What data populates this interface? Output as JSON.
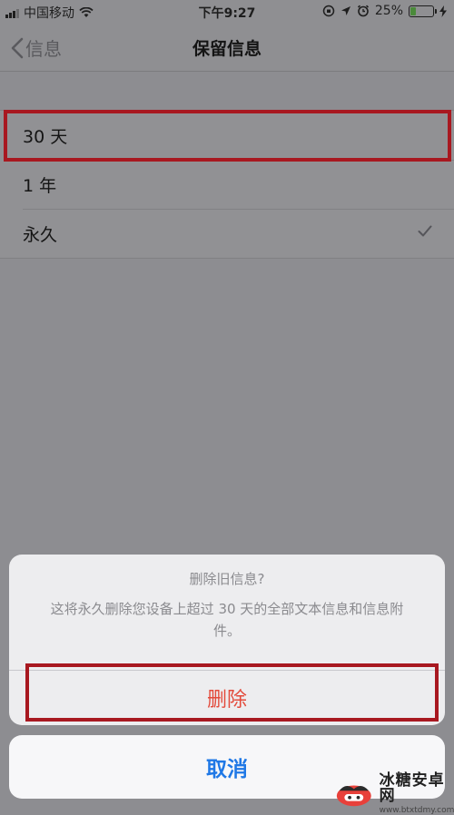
{
  "status_bar": {
    "carrier": "中国移动",
    "time": "下午9:27",
    "battery_percent": "25%",
    "battery_level": 0.25,
    "battery_color": "#4a8a3a"
  },
  "nav": {
    "back_label": "信息",
    "title": "保留信息"
  },
  "options": [
    {
      "label": "30 天",
      "selected": false
    },
    {
      "label": "1 年",
      "selected": false
    },
    {
      "label": "永久",
      "selected": true
    }
  ],
  "action_sheet": {
    "title": "删除旧信息?",
    "message": "这将永久删除您设备上超过 30 天的全部文本信息和信息附件。",
    "destructive_label": "删除",
    "destructive_color": "#e34a3b",
    "cancel_label": "取消",
    "cancel_color": "#1f78e6"
  },
  "highlight_color": "#a81820",
  "watermark": {
    "name": "冰糖安卓网",
    "url": "www.btxtdmy.com"
  },
  "icons": [
    "signal-icon",
    "wifi-icon",
    "orientation-lock-icon",
    "location-icon",
    "alarm-icon",
    "battery-icon",
    "charging-icon",
    "chevron-left-icon",
    "checkmark-icon"
  ]
}
